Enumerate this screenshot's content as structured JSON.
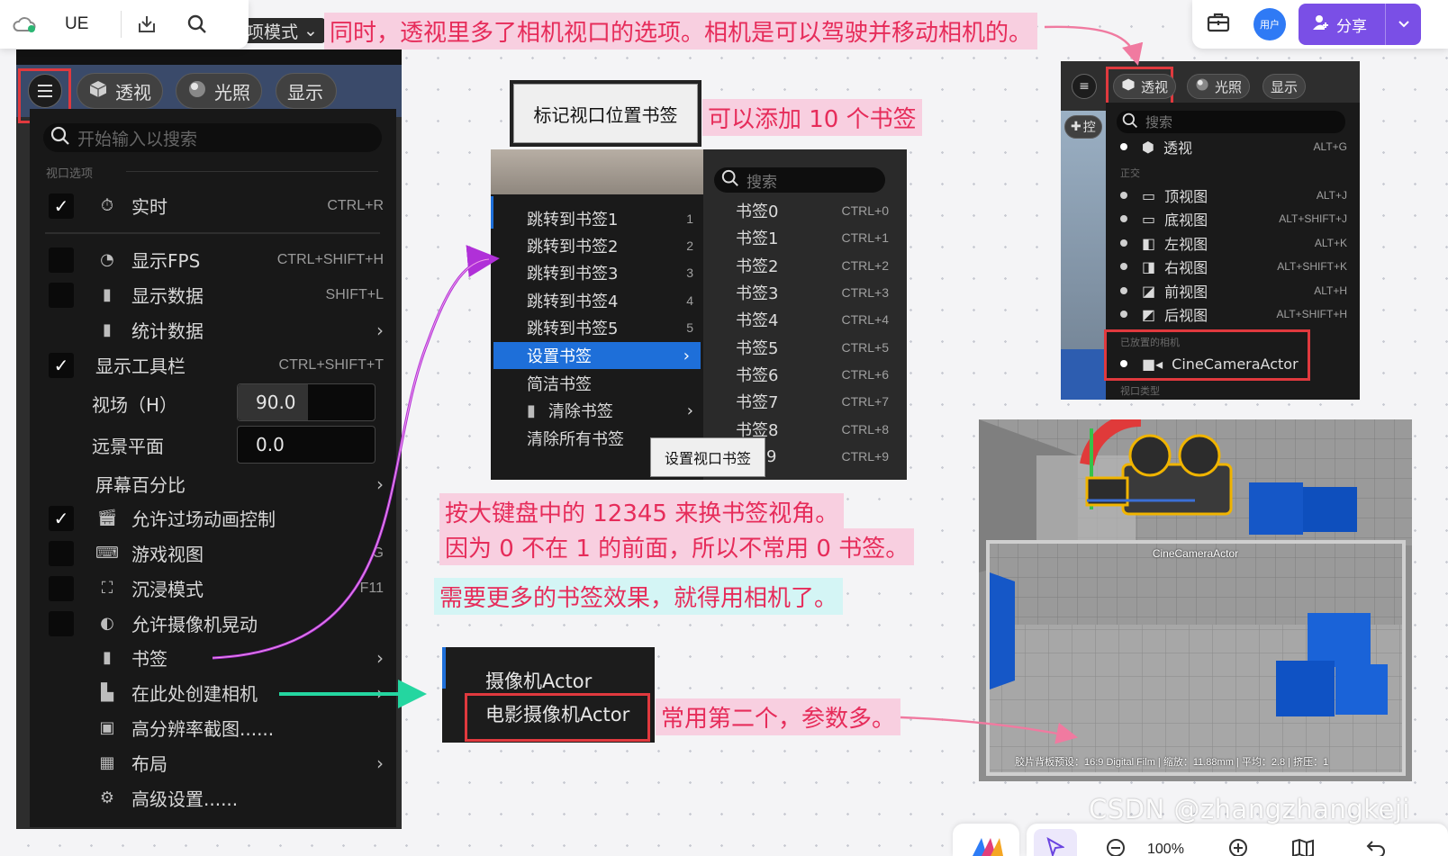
{
  "topbar": {
    "doc_title": "UE",
    "avatar_label": "用户",
    "share_label": "分享"
  },
  "ue_panel": {
    "mode_chip": "项模式",
    "pill_perspective": "透视",
    "pill_lighting": "光照",
    "pill_show": "显示",
    "search_placeholder": "开始输入以搜索",
    "section_viewport_options": "视口选项",
    "items": [
      {
        "label": "实时",
        "shortcut": "CTRL+R",
        "checked": true
      },
      {
        "label": "显示FPS",
        "shortcut": "CTRL+SHIFT+H",
        "checked": false
      },
      {
        "label": "显示数据",
        "shortcut": "SHIFT+L",
        "checked": false
      },
      {
        "label": "统计数据",
        "shortcut": "",
        "checked": null
      },
      {
        "label": "显示工具栏",
        "shortcut": "CTRL+SHIFT+T",
        "checked": true
      },
      {
        "label": "视场（H）",
        "value": "90.0"
      },
      {
        "label": "远景平面",
        "value": "0.0"
      },
      {
        "label": "屏幕百分比"
      },
      {
        "label": "允许过场动画控制",
        "checked": true
      },
      {
        "label": "游戏视图",
        "shortcut": "G",
        "checked": false
      },
      {
        "label": "沉浸模式",
        "shortcut": "F11",
        "checked": false
      },
      {
        "label": "允许摄像机晃动",
        "checked": false
      },
      {
        "label": "书签"
      },
      {
        "label": "在此处创建相机"
      },
      {
        "label": "高分辨率截图......"
      },
      {
        "label": "布局"
      },
      {
        "label": "高级设置......"
      }
    ]
  },
  "notes": {
    "top": "同时，透视里多了相机视口的选项。相机是可以驾驶并移动相机的。",
    "bookmarks_count": "可以添加 10 个书签",
    "keys_line1": "按大键盘中的 12345 来换书签视角。",
    "keys_line2": "因为 0 不在 1 的前面，所以不常用 0 书签。",
    "need_camera": "需要更多的书签效果，就得用相机了。",
    "second_more_params": "常用第二个，参数多。"
  },
  "bookmark_menu": {
    "title": "标记视口位置书签",
    "search_placeholder": "搜索",
    "jump_items": [
      {
        "label": "跳转到书签1",
        "key": "1"
      },
      {
        "label": "跳转到书签2",
        "key": "2"
      },
      {
        "label": "跳转到书签3",
        "key": "3"
      },
      {
        "label": "跳转到书签4",
        "key": "4"
      },
      {
        "label": "跳转到书签5",
        "key": "5"
      }
    ],
    "set_bookmark": "设置书签",
    "compact_bookmark": "简洁书签",
    "clear_bookmark": "清除书签",
    "clear_all_bookmarks": "清除所有书签",
    "tooltip": "设置视口书签",
    "bookmarks": [
      {
        "label": "书签0",
        "key": "CTRL+0"
      },
      {
        "label": "书签1",
        "key": "CTRL+1"
      },
      {
        "label": "书签2",
        "key": "CTRL+2"
      },
      {
        "label": "书签3",
        "key": "CTRL+3"
      },
      {
        "label": "书签4",
        "key": "CTRL+4"
      },
      {
        "label": "书签5",
        "key": "CTRL+5"
      },
      {
        "label": "书签6",
        "key": "CTRL+6"
      },
      {
        "label": "书签7",
        "key": "CTRL+7"
      },
      {
        "label": "书签8",
        "key": "CTRL+8"
      },
      {
        "label": "9",
        "key": "CTRL+9"
      }
    ]
  },
  "camera_menu": {
    "item1": "摄像机Actor",
    "item2": "电影摄像机Actor"
  },
  "viewport_menu": {
    "pill_perspective": "透视",
    "pill_lighting": "光照",
    "pill_show": "显示",
    "side_label": "控",
    "search_placeholder": "搜索",
    "perspective_item": {
      "label": "透视",
      "key": "ALT+G"
    },
    "section_ortho": "正交",
    "ortho_items": [
      {
        "label": "顶视图",
        "key": "ALT+J"
      },
      {
        "label": "底视图",
        "key": "ALT+SHIFT+J"
      },
      {
        "label": "左视图",
        "key": "ALT+K"
      },
      {
        "label": "右视图",
        "key": "ALT+SHIFT+K"
      },
      {
        "label": "前视图",
        "key": "ALT+H"
      },
      {
        "label": "后视图",
        "key": "ALT+SHIFT+H"
      }
    ],
    "section_placed_cameras": "已放置的相机",
    "camera_item": "CineCameraActor",
    "section_viewport_type": "视口类型"
  },
  "scene": {
    "camera_label": "CineCameraActor",
    "status_text": "胶片背板预设：16:9 Digital Film | 缩放：11.88mm | 平均：2.8 | 挤压：1"
  },
  "bottom": {
    "zoom": "100%"
  },
  "watermark": "CSDN @zhangzhangkeji",
  "colors": {
    "note_text": "#e62c5a",
    "note_pink_bg": "#f8cfe0",
    "note_cyan_bg": "#d4f5f5",
    "highlight_red": "#e0393e",
    "ue_selected": "#1e6fd9",
    "share_purple": "#7a4fe6"
  }
}
